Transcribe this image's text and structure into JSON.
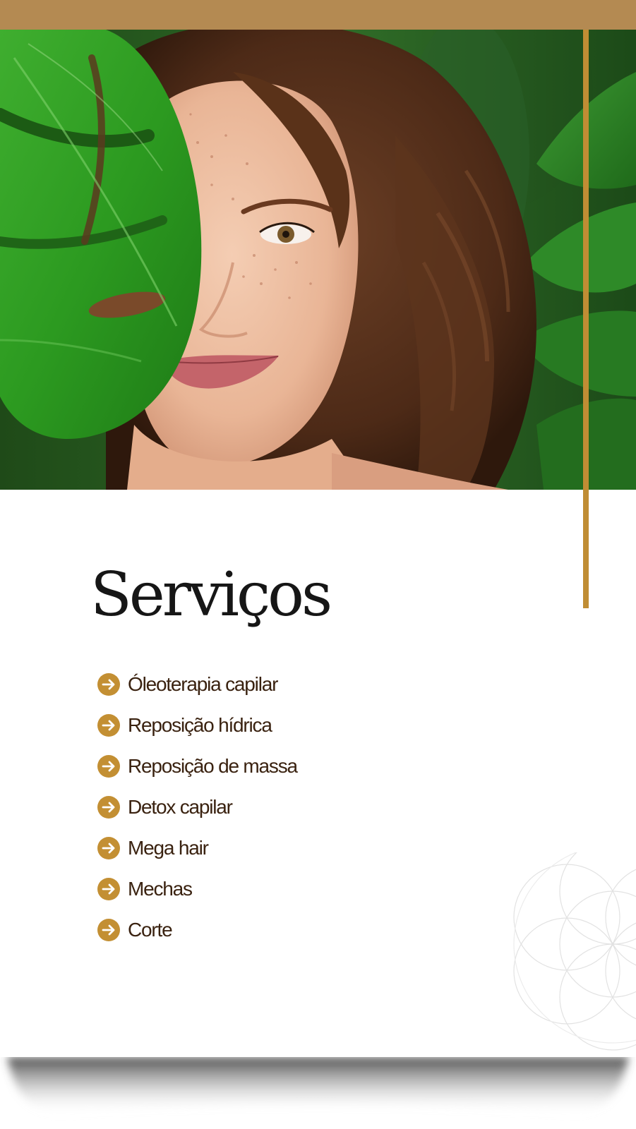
{
  "brand": {
    "accent_color": "#b48a52",
    "gold_line_color": "#c08d34",
    "icon_color": "#c38f33",
    "text_color": "#3a2210",
    "title_color": "#161616"
  },
  "hero": {
    "image_description_icon": "woman-portrait-with-monstera-leaf"
  },
  "services": {
    "title": "Serviços",
    "icon": "arrow-right-circle-icon",
    "items": [
      {
        "label": "Óleoterapia capilar"
      },
      {
        "label": "Reposição hídrica"
      },
      {
        "label": "Reposição de massa"
      },
      {
        "label": "Detox capilar"
      },
      {
        "label": "Mega hair"
      },
      {
        "label": "Mechas"
      },
      {
        "label": "Corte"
      }
    ]
  }
}
